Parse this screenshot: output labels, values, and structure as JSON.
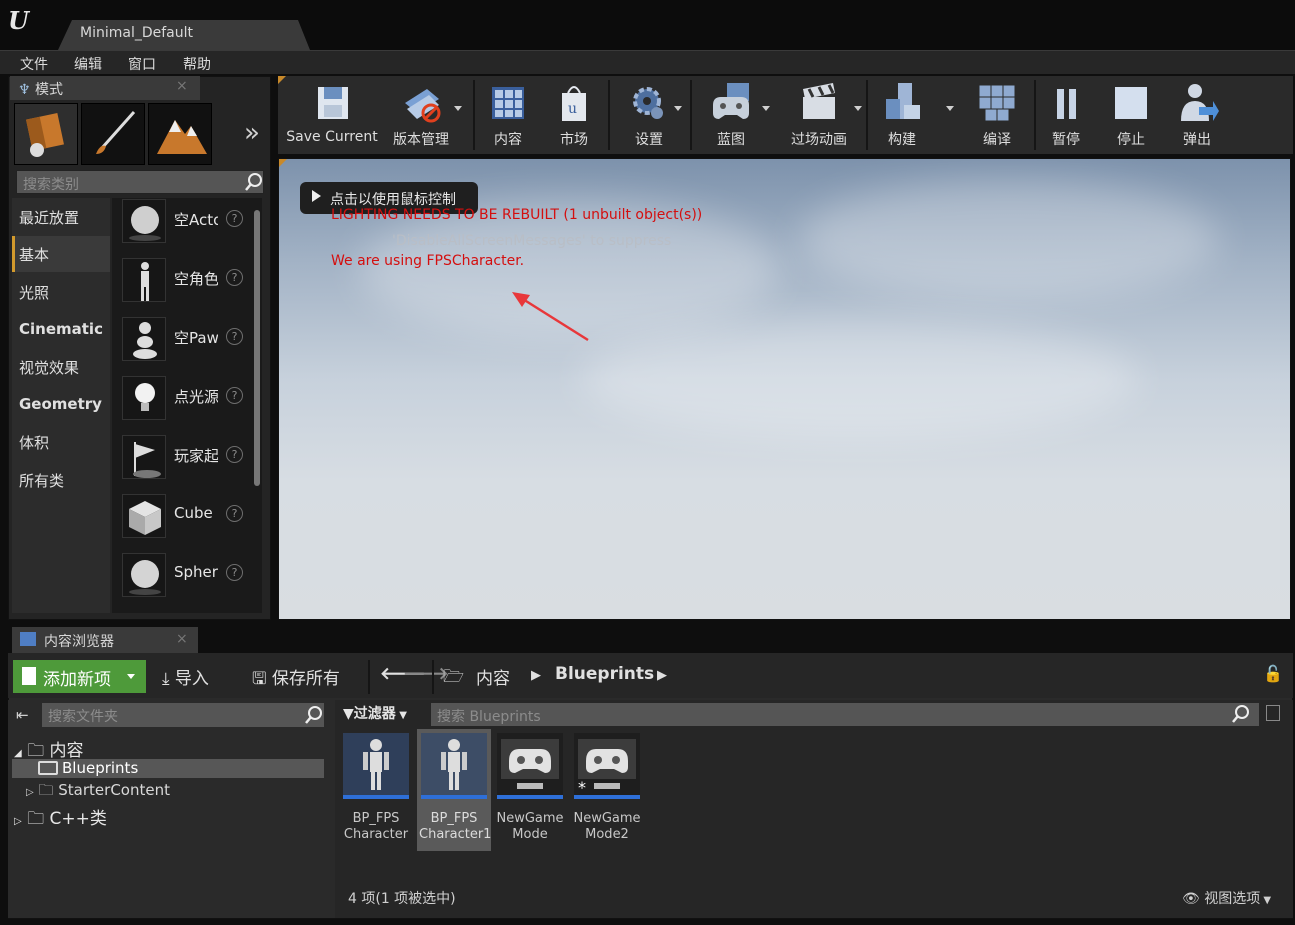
{
  "window": {
    "logo": "U",
    "map_tab": "Minimal_Default"
  },
  "menu": [
    "文件",
    "编辑",
    "窗口",
    "帮助"
  ],
  "modes": {
    "tab_label": "模式",
    "close_glyph": "×",
    "more_glyph": "»",
    "search_placeholder": "搜索类别",
    "categories": [
      "最近放置",
      "基本",
      "光照",
      "Cinematic",
      "视觉效果",
      "Geometry",
      "体积",
      "所有类"
    ],
    "selected_category": "基本",
    "actors": [
      "空Actor",
      "空角色",
      "空Pawn",
      "点光源",
      "玩家起",
      "Cube",
      "Sphere"
    ],
    "help_glyph": "?"
  },
  "toolbar": {
    "buttons": [
      "Save Current",
      "版本管理",
      "内容",
      "市场",
      "设置",
      "蓝图",
      "过场动画",
      "构建",
      "编译",
      "暂停",
      "停止",
      "弹出"
    ]
  },
  "viewport": {
    "mouse_tip": "点击以使用鼠标控制",
    "messages": [
      "LIGHTING NEEDS TO BE REBUILT (1 unbuilt object(s))",
      "'DisableAllScreenMessages' to suppress",
      "We are using FPSCharacter."
    ],
    "colors": {
      "error_red": "#d40f0f",
      "suppress_gray": "#b9bec6",
      "annotation_arrow": "#e8373a"
    }
  },
  "content_browser": {
    "tab_label": "内容浏览器",
    "close_glyph": "×",
    "add_new": "添加新项",
    "import": "导入",
    "save_all": "保存所有",
    "path": [
      "内容",
      "Blueprints"
    ],
    "folder_search_placeholder": "搜索文件夹",
    "folders": {
      "root": "内容",
      "children": [
        "Blueprints",
        "StarterContent"
      ],
      "cpp": "C++类"
    },
    "filter_label": "过滤器",
    "asset_search_placeholder": "搜索 Blueprints",
    "assets": [
      {
        "line1": "BP_FPS",
        "line2": "Character",
        "kind": "character-icon"
      },
      {
        "line1": "BP_FPS",
        "line2": "Character1",
        "kind": "character-icon",
        "selected": true
      },
      {
        "line1": "NewGame",
        "line2": "Mode",
        "kind": "gamepad-icon"
      },
      {
        "line1": "NewGame",
        "line2": "Mode2",
        "kind": "gamepad-icon"
      }
    ],
    "status": "4 项(1 项被选中)",
    "view_options": "视图选项"
  },
  "colors": {
    "accent_green": "#4e9a3a",
    "selection_orange": "#d29a2d",
    "asset_blue": "#2e6fd8"
  }
}
